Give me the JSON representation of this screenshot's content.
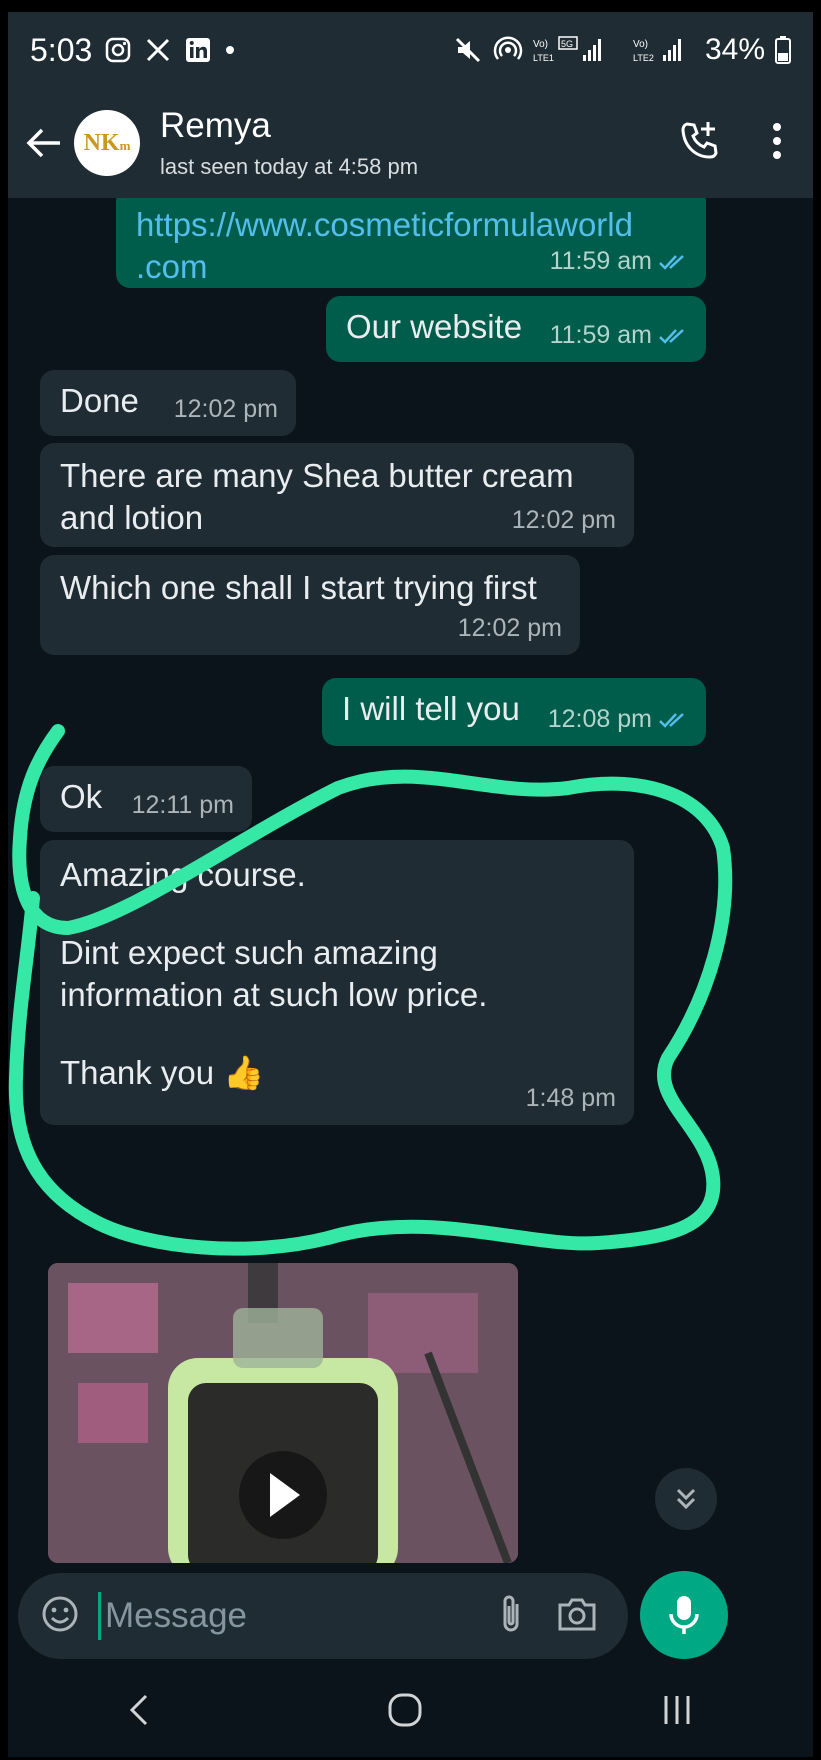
{
  "status_bar": {
    "time": "5:03",
    "battery": "34%"
  },
  "header": {
    "avatar_text": "NK",
    "avatar_sub": "m",
    "contact_name": "Remya",
    "last_seen": "last seen today at 4:58 pm"
  },
  "messages": [
    {
      "dir": "out",
      "text_line1": "https://www.cosmeticformulaworld",
      "text_line2": ".com",
      "time": "11:59 am",
      "ticks": "read"
    },
    {
      "dir": "out",
      "text": "Our website",
      "time": "11:59 am",
      "ticks": "read"
    },
    {
      "dir": "in",
      "text": "Done",
      "time": "12:02 pm"
    },
    {
      "dir": "in",
      "text_line1": "There are many Shea butter cream",
      "text_line2": "and lotion",
      "time": "12:02 pm"
    },
    {
      "dir": "in",
      "text": "Which one shall I start trying first",
      "time": "12:02 pm"
    },
    {
      "dir": "out",
      "text": "I will tell you",
      "time": "12:08 pm",
      "ticks": "read"
    },
    {
      "dir": "in",
      "text": "Ok",
      "time": "12:11 pm"
    },
    {
      "dir": "in",
      "line1": "Amazing course.",
      "line2": "Dint expect such amazing",
      "line3": "information at such low price.",
      "line4": "Thank you",
      "emoji": "👍",
      "time": "1:48 pm"
    }
  ],
  "input": {
    "placeholder": "Message"
  },
  "colors": {
    "accent": "#00a884",
    "highlight": "#35e8a6",
    "outgoing_bubble": "#005c4b",
    "incoming_bubble": "#1f2c34"
  }
}
